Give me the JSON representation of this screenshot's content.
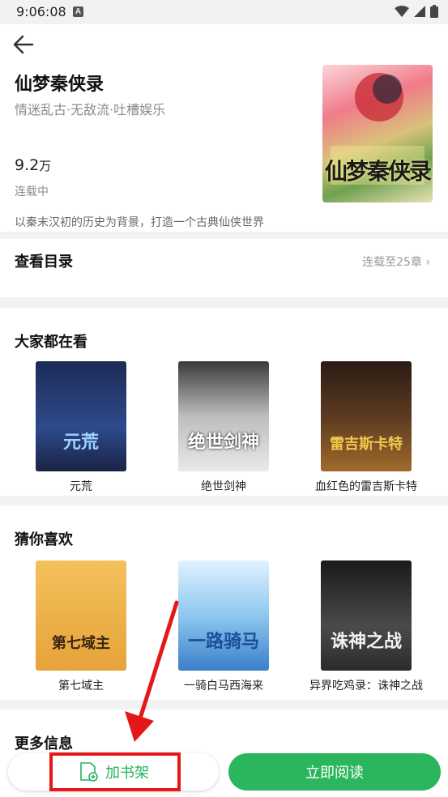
{
  "status": {
    "time": "9:06:08",
    "notif": "A"
  },
  "book": {
    "title": "仙梦秦侠录",
    "tags": "情迷乱古·无敌流·吐槽娱乐",
    "count_num": "9.2",
    "count_unit": "万",
    "state": "连载中",
    "desc": "以秦末汉初的历史为背景，打造一个古典仙侠世界",
    "cover_text": "仙梦秦侠录"
  },
  "catalog": {
    "label": "查看目录",
    "status": "连载至25章"
  },
  "sections": {
    "popular": {
      "title": "大家都在看",
      "books": [
        {
          "name": "元荒",
          "cover_text": "元荒"
        },
        {
          "name": "绝世剑神",
          "cover_text": "绝世剑神"
        },
        {
          "name": "血红色的雷吉斯卡特",
          "cover_text": "雷吉斯卡特"
        }
      ]
    },
    "guess": {
      "title": "猜你喜欢",
      "books": [
        {
          "name": "第七域主",
          "cover_text": "第七域主"
        },
        {
          "name": "一骑白马西海来",
          "cover_text": "一路骑马"
        },
        {
          "name": "异界吃鸡录：诛神之战",
          "cover_text": "诛神之战"
        }
      ]
    },
    "more": {
      "title": "更多信息"
    }
  },
  "actions": {
    "add_shelf": "加书架",
    "read_now": "立即阅读"
  },
  "colors": {
    "accent": "#2bb65d",
    "highlight": "#e41818"
  }
}
